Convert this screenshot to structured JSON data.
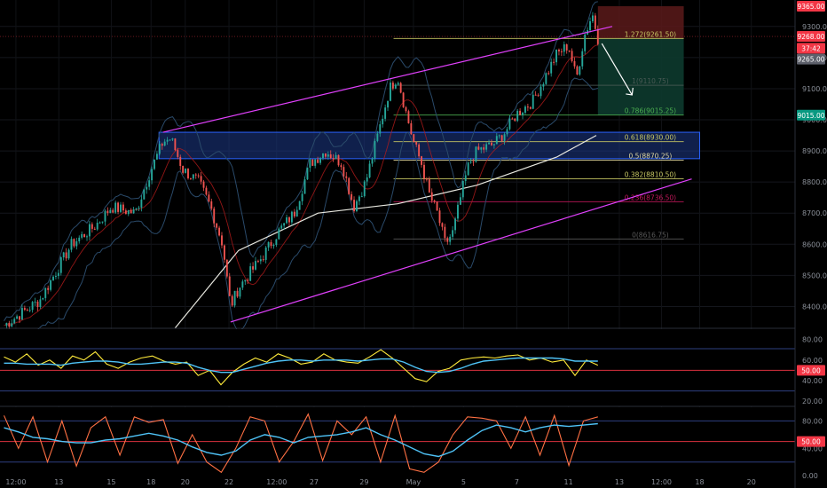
{
  "chart_data": [
    {
      "type": "line",
      "panel": "price",
      "title": "",
      "xlabel": "",
      "ylabel": "",
      "ylim": [
        8330,
        9385
      ],
      "y_ticks": [
        "9300.00",
        "9200.00",
        "9100.00",
        "9000.00",
        "8900.00",
        "8800.00",
        "8700.00",
        "8600.00",
        "8500.00",
        "8400.00"
      ],
      "y_tick_values": [
        9300,
        9200,
        9100,
        9000,
        8900,
        8800,
        8700,
        8600,
        8500,
        8400
      ],
      "x_ticks": [
        "12:00",
        "13",
        "15",
        "18",
        "20",
        "22",
        "12:00",
        "27",
        "29",
        "May",
        "5",
        "7",
        "11",
        "13",
        "12:00",
        "18",
        "20"
      ],
      "x_tick_positions": [
        0.02,
        0.074,
        0.14,
        0.19,
        0.233,
        0.288,
        0.348,
        0.395,
        0.458,
        0.52,
        0.583,
        0.65,
        0.715,
        0.779,
        0.832,
        0.88,
        0.945
      ],
      "price_path": [
        [
          0.0,
          8330
        ],
        [
          0.05,
          8420
        ],
        [
          0.09,
          8600
        ],
        [
          0.12,
          8660
        ],
        [
          0.14,
          8720
        ],
        [
          0.17,
          8700
        ],
        [
          0.19,
          8840
        ],
        [
          0.205,
          8930
        ],
        [
          0.215,
          8940
        ],
        [
          0.23,
          8840
        ],
        [
          0.25,
          8800
        ],
        [
          0.265,
          8720
        ],
        [
          0.28,
          8600
        ],
        [
          0.29,
          8400
        ],
        [
          0.3,
          8460
        ],
        [
          0.33,
          8560
        ],
        [
          0.35,
          8640
        ],
        [
          0.37,
          8700
        ],
        [
          0.39,
          8860
        ],
        [
          0.41,
          8900
        ],
        [
          0.43,
          8860
        ],
        [
          0.445,
          8720
        ],
        [
          0.46,
          8800
        ],
        [
          0.47,
          8900
        ],
        [
          0.49,
          9100
        ],
        [
          0.5,
          9140
        ],
        [
          0.51,
          9030
        ],
        [
          0.52,
          8930
        ],
        [
          0.53,
          8860
        ],
        [
          0.54,
          8760
        ],
        [
          0.55,
          8700
        ],
        [
          0.56,
          8600
        ],
        [
          0.57,
          8640
        ],
        [
          0.58,
          8760
        ],
        [
          0.59,
          8860
        ],
        [
          0.6,
          8900
        ],
        [
          0.62,
          8920
        ],
        [
          0.635,
          8960
        ],
        [
          0.65,
          9020
        ],
        [
          0.67,
          9060
        ],
        [
          0.69,
          9160
        ],
        [
          0.7,
          9210
        ],
        [
          0.715,
          9240
        ],
        [
          0.725,
          9130
        ],
        [
          0.735,
          9270
        ],
        [
          0.745,
          9340
        ],
        [
          0.752,
          9262
        ]
      ],
      "moving_average_path": [
        [
          0.22,
          8330
        ],
        [
          0.3,
          8580
        ],
        [
          0.4,
          8700
        ],
        [
          0.5,
          8730
        ],
        [
          0.6,
          8790
        ],
        [
          0.7,
          8880
        ],
        [
          0.75,
          8950
        ]
      ],
      "channel_upper": [
        [
          0.205,
          8960
        ],
        [
          0.77,
          9300
        ]
      ],
      "channel_lower": [
        [
          0.29,
          8350
        ],
        [
          0.87,
          8810
        ]
      ],
      "demand_zone": {
        "x": [
          0.2,
          0.88
        ],
        "y": [
          8875,
          8960
        ]
      },
      "fibonacci_levels": [
        {
          "label": "1.272(9261.50)",
          "value": 9261.5,
          "color": "#c8c864"
        },
        {
          "label": "1(9110.75)",
          "value": 9110.75,
          "color": "#4a5a55"
        },
        {
          "label": "0.786(9015.25)",
          "value": 9015.25,
          "color": "#4caf50"
        },
        {
          "label": "0.618(8930.00)",
          "value": 8930.0,
          "color": "#c8c864"
        },
        {
          "label": "0.5(8870.25)",
          "value": 8870.25,
          "color": "#e0d8a0"
        },
        {
          "label": "0.382(8810.50)",
          "value": 8810.5,
          "color": "#c8c864"
        },
        {
          "label": "0.236(8736.50)",
          "value": 8736.5,
          "color": "#c2185b"
        },
        {
          "label": "0(8616.75)",
          "value": 8616.75,
          "color": "#5a5a5a"
        }
      ],
      "short_position": {
        "entry": 9262,
        "stop": 9365,
        "target": 9015,
        "x": [
          0.752,
          0.86
        ]
      },
      "price_labels": [
        {
          "text": "9365.00",
          "value": 9365,
          "color": "#f23645"
        },
        {
          "text": "9268.00",
          "value": 9268,
          "color": "#f23645"
        },
        {
          "text": "37:42",
          "value": 9230,
          "color": "#f23645"
        },
        {
          "text": "9265.00",
          "value": 9195,
          "color": "#5d606b"
        },
        {
          "text": "9015.00",
          "value": 9015,
          "color": "#089981"
        }
      ]
    },
    {
      "type": "line",
      "panel": "oscillator-1",
      "title": "",
      "ylim": [
        15,
        90
      ],
      "y_ticks": [
        "80.00",
        "60.00",
        "40.00",
        "20.00"
      ],
      "y_tick_values": [
        80,
        60,
        40,
        20
      ],
      "level_lines": [
        71,
        50,
        30
      ],
      "series": [
        {
          "color": "#ffeb3b",
          "values": [
            63,
            58,
            66,
            55,
            60,
            52,
            64,
            60,
            68,
            56,
            52,
            58,
            62,
            64,
            59,
            56,
            58,
            45,
            50,
            36,
            48,
            56,
            62,
            58,
            66,
            62,
            56,
            58,
            66,
            60,
            58,
            57,
            63,
            70,
            62,
            52,
            42,
            39,
            49,
            52,
            60,
            62,
            63,
            62,
            64,
            65,
            60,
            62,
            58,
            60,
            45,
            60,
            55
          ]
        },
        {
          "color": "#4fc3f7",
          "values": [
            57,
            57,
            56,
            56,
            56,
            55,
            57,
            58,
            59,
            59,
            58,
            56,
            56,
            57,
            58,
            58,
            57,
            53,
            50,
            48,
            48,
            51,
            54,
            57,
            59,
            60,
            60,
            59,
            60,
            60,
            60,
            59,
            60,
            61,
            61,
            58,
            53,
            49,
            48,
            49,
            52,
            56,
            59,
            60,
            61,
            62,
            62,
            62,
            62,
            61,
            59,
            59,
            59
          ]
        }
      ],
      "badge": {
        "text": "50.00",
        "value": 50
      }
    },
    {
      "type": "line",
      "panel": "oscillator-2",
      "title": "",
      "ylim": [
        -5,
        100
      ],
      "y_ticks": [
        "80.00",
        "40.00",
        "0.00"
      ],
      "y_tick_values": [
        80,
        40,
        0
      ],
      "level_lines": [
        80,
        50,
        20
      ],
      "series": [
        {
          "color": "#ff7043",
          "values": [
            88,
            40,
            86,
            20,
            80,
            14,
            70,
            86,
            30,
            86,
            78,
            82,
            18,
            60,
            20,
            5,
            40,
            86,
            80,
            20,
            50,
            90,
            22,
            80,
            60,
            86,
            20,
            88,
            10,
            5,
            20,
            60,
            86,
            84,
            80,
            40,
            86,
            30,
            88,
            15,
            80,
            86
          ]
        },
        {
          "color": "#4fc3f7",
          "values": [
            70,
            64,
            56,
            54,
            50,
            48,
            48,
            52,
            54,
            58,
            62,
            58,
            52,
            42,
            34,
            30,
            36,
            52,
            60,
            56,
            48,
            56,
            58,
            60,
            64,
            70,
            60,
            52,
            42,
            32,
            28,
            36,
            52,
            66,
            74,
            70,
            64,
            70,
            74,
            72,
            74,
            76
          ]
        }
      ],
      "badge": {
        "text": "50.00",
        "value": 50
      }
    }
  ],
  "colors": {
    "background": "#000000",
    "channel": "#e040fb",
    "zone_fill": "#1e3a8a",
    "zone_edge": "#2962ff",
    "up_candle": "#26a69a",
    "down_candle": "#ef5350",
    "bollinger": "#2a4a6a",
    "moving_average": "#e8e8e0",
    "short_arrow": "#ffffff",
    "stop_area": "#5a1a1a",
    "target_area": "#0d3a2e",
    "accent_red": "#f23645"
  }
}
